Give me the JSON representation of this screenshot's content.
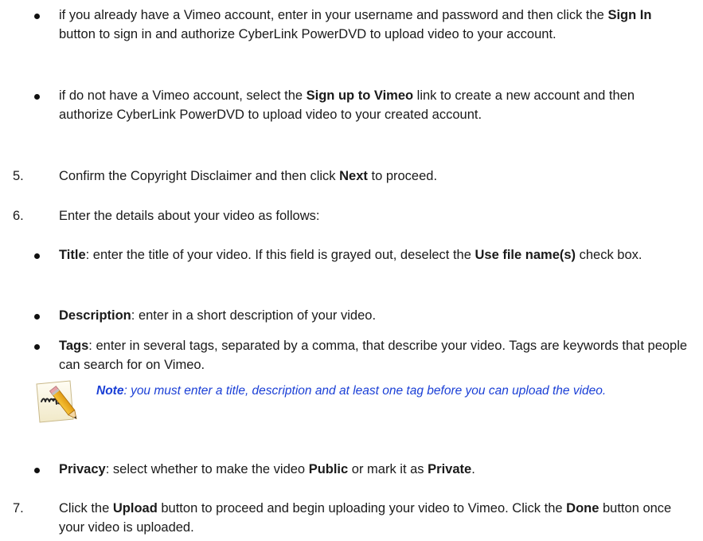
{
  "bullets_top": [
    {
      "pre": "if you already have a Vimeo account, enter in your username and password and then click the ",
      "bold": "Sign In",
      "post": " button to sign in and authorize CyberLink PowerDVD to upload video to your account."
    },
    {
      "pre": "if do not have a Vimeo account, select the ",
      "bold": "Sign up to Vimeo",
      "post": " link to create a new account and then authorize CyberLink PowerDVD to upload video to your created account."
    }
  ],
  "step5": {
    "num": "5.",
    "pre": "Confirm the Copyright Disclaimer and then click ",
    "bold": "Next",
    "post": " to proceed."
  },
  "step6": {
    "num": "6.",
    "text": "Enter the details about your video as follows:"
  },
  "details": [
    {
      "label": "Title",
      "pre": ": enter the title of your video. If this field is grayed out, deselect the ",
      "bold": "Use file name(s)",
      "post": " check box."
    },
    {
      "label": "Description",
      "pre": ": enter in a short description of your video.",
      "bold": "",
      "post": ""
    },
    {
      "label": "Tags",
      "pre": ": enter in several tags, separated by a comma, that describe your video. Tags are keywords that people can search for on Vimeo.",
      "bold": "",
      "post": ""
    }
  ],
  "note": {
    "icon": "note-pencil-icon",
    "label": "Note",
    "text": ": you must enter a title, description and at least one tag before you can upload the video."
  },
  "privacy": {
    "label": "Privacy",
    "pre": ": select whether to make the video ",
    "bold1": "Public",
    "mid": " or mark it as ",
    "bold2": "Private",
    "post": "."
  },
  "step7": {
    "num": "7.",
    "pre": "Click the ",
    "bold1": "Upload",
    "mid": " button to proceed and begin uploading your video to Vimeo. Click the ",
    "bold2": "Done",
    "post": " button once your video is uploaded."
  }
}
